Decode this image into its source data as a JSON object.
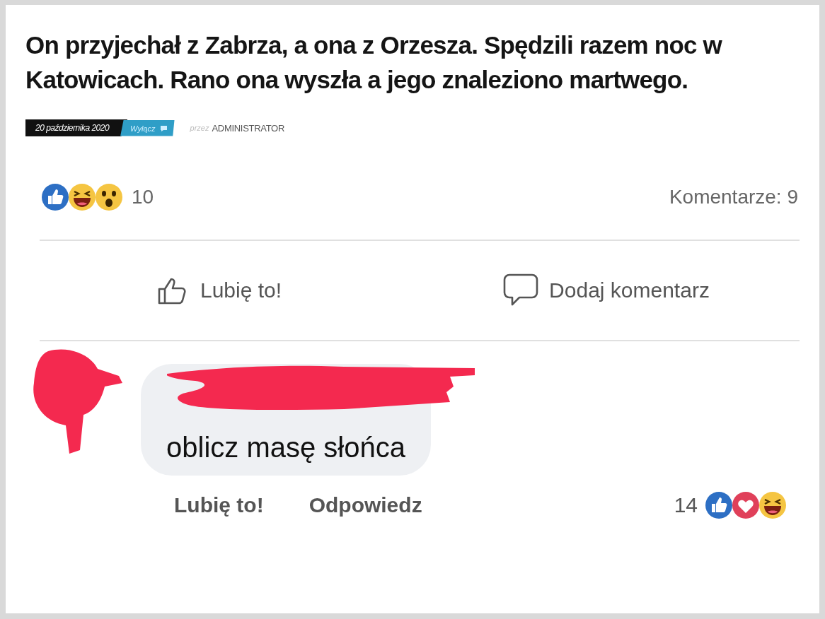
{
  "headline": "On przyjechał z Zabrza, a ona z Orzesza. Spędzili razem noc w Katowicach. Rano ona wyszła a jego znaleziono martwego.",
  "meta": {
    "date": "20 października 2020",
    "comments_tag": "Wyłącz",
    "by_label": "przez",
    "author": "ADMINISTRATOR"
  },
  "post_reactions": {
    "icons": [
      {
        "kind": "like"
      },
      {
        "kind": "haha"
      },
      {
        "kind": "wow"
      }
    ],
    "count": "10",
    "comments": "Komentarze: 9"
  },
  "actions": [
    {
      "kind": "like",
      "label": "Lubię to!"
    },
    {
      "kind": "comment",
      "label": "Dodaj komentarz"
    }
  ],
  "comment": {
    "text": "oblicz masę słońca",
    "actions": [
      "Lubię to!",
      "Odpowiedz"
    ],
    "reaction_count": "14",
    "reactions": [
      {
        "kind": "like"
      },
      {
        "kind": "love"
      },
      {
        "kind": "haha"
      }
    ]
  }
}
